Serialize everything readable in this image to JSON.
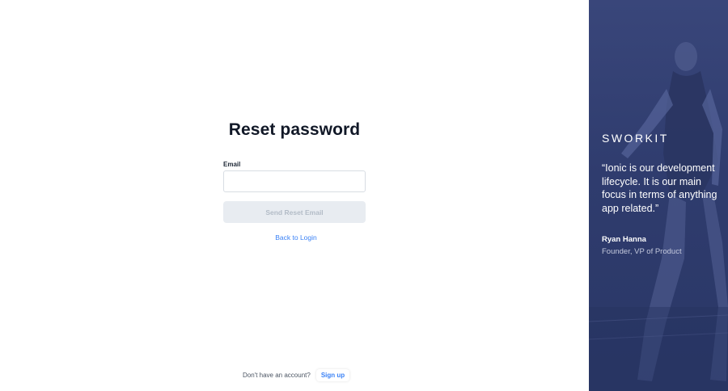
{
  "reset": {
    "title": "Reset password",
    "email_label": "Email",
    "email_value": "",
    "send_button": "Send Reset Email",
    "back_link": "Back to Login"
  },
  "signup": {
    "prompt": "Don't have an account?",
    "button": "Sign up"
  },
  "testimonial": {
    "logo_text": "SWORKIT",
    "quote": "“Ionic is our development lifecycle. It is our main focus in terms of anything app related.”",
    "author_name": "Ryan Hanna",
    "author_role": "Founder, VP of Product",
    "panel_color": "#33406f"
  },
  "colors": {
    "link": "#3b82f6",
    "disabled_button_bg": "#e8ecf1",
    "disabled_button_text": "#b3bcc7",
    "title": "#111827"
  }
}
